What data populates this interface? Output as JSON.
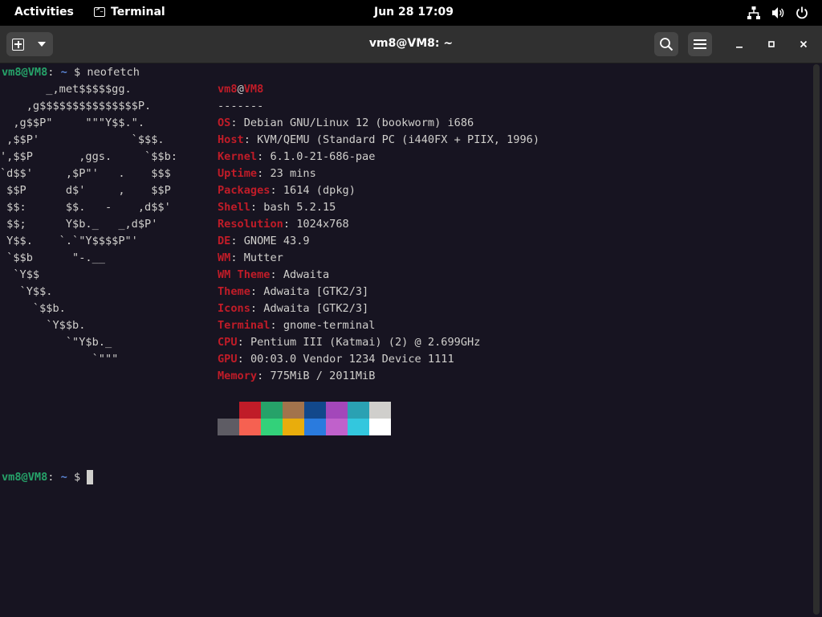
{
  "topbar": {
    "activities": "Activities",
    "app_name": "Terminal",
    "clock": "Jun 28  17:09"
  },
  "window": {
    "title": "vm8@VM8: ~"
  },
  "terminal": {
    "prompt_user": "vm8@VM8",
    "prompt_sep": ":",
    "prompt_path": " ~",
    "prompt_dollar": " $ ",
    "command": "neofetch",
    "logo_lines": [
      "       _,met$$$$$gg.",
      "    ,g$$$$$$$$$$$$$$$P.",
      "  ,g$$P\"     \"\"\"Y$$.\".",
      " ,$$P'              `$$$.",
      "',$$P       ,ggs.     `$$b:",
      "`d$$'     ,$P\"'   .    $$$",
      " $$P      d$'     ,    $$P",
      " $$:      $$.   -    ,d$$'",
      " $$;      Y$b._   _,d$P'",
      " Y$$.    `.`\"Y$$$$P\"'",
      " `$$b      \"-.__",
      "  `Y$$",
      "   `Y$$.",
      "     `$$b.",
      "       `Y$$b.",
      "          `\"Y$b._",
      "              `\"\"\""
    ],
    "header_user": "vm8",
    "header_at": "@",
    "header_host": "VM8",
    "separator": "-------",
    "info": [
      {
        "key": "OS",
        "value": "Debian GNU/Linux 12 (bookworm) i686"
      },
      {
        "key": "Host",
        "value": "KVM/QEMU (Standard PC (i440FX + PIIX, 1996)"
      },
      {
        "key": "Kernel",
        "value": "6.1.0-21-686-pae"
      },
      {
        "key": "Uptime",
        "value": "23 mins"
      },
      {
        "key": "Packages",
        "value": "1614 (dpkg)"
      },
      {
        "key": "Shell",
        "value": "bash 5.2.15"
      },
      {
        "key": "Resolution",
        "value": "1024x768"
      },
      {
        "key": "DE",
        "value": "GNOME 43.9"
      },
      {
        "key": "WM",
        "value": "Mutter"
      },
      {
        "key": "WM Theme",
        "value": "Adwaita"
      },
      {
        "key": "Theme",
        "value": "Adwaita [GTK2/3]"
      },
      {
        "key": "Icons",
        "value": "Adwaita [GTK2/3]"
      },
      {
        "key": "Terminal",
        "value": "gnome-terminal"
      },
      {
        "key": "CPU",
        "value": "Pentium III (Katmai) (2) @ 2.699GHz"
      },
      {
        "key": "GPU",
        "value": "00:03.0 Vendor 1234 Device 1111"
      },
      {
        "key": "Memory",
        "value": "775MiB / 2011MiB"
      }
    ],
    "palette_top": [
      "#171421",
      "#c01c28",
      "#26a269",
      "#a2734c",
      "#12488b",
      "#a347ba",
      "#2aa1b3",
      "#d0cfcc"
    ],
    "palette_bottom": [
      "#5e5c64",
      "#f66151",
      "#33d17a",
      "#e9ad0c",
      "#2a7bde",
      "#c061cb",
      "#33c7de",
      "#ffffff"
    ]
  },
  "colors": {
    "accent_red": "#c01c28",
    "prompt_green": "#26a269",
    "prompt_blue": "#5b86d6",
    "terminal_bg": "#171421"
  }
}
